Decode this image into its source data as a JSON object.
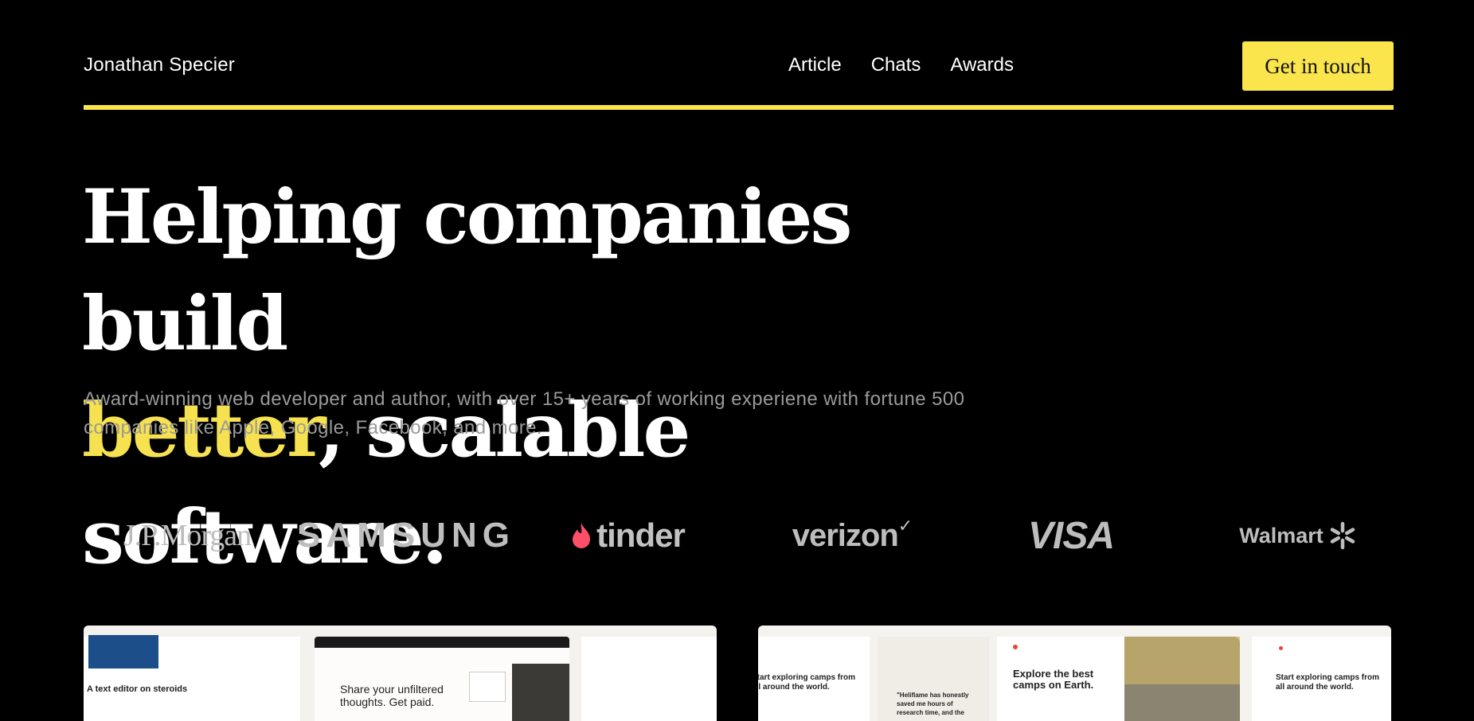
{
  "header": {
    "brand": "Jonathan Specier",
    "nav": [
      "Article",
      "Chats",
      "Awards"
    ],
    "cta_label": "Get in touch"
  },
  "hero": {
    "title_line1": "Helping companies build",
    "title_highlight": "better",
    "title_rest": ", scalable software.",
    "subtitle": "Award-winning web developer and author, with over 15+ years of working experiene with fortune 500 companies like Apple, Google, Facebook, and more."
  },
  "logos": {
    "jpmorgan": "J.P.Morgan",
    "samsung": "SAMSUNG",
    "tinder": "tinder",
    "verizon": "verizon",
    "visa": "VISA",
    "walmart": "Walmart"
  },
  "showcase": {
    "project1": {
      "headline": "Share your unfiltered thoughts. Get paid.",
      "side_left": "A text editor on steroids"
    },
    "project2": {
      "intro": "Start exploring camps from all around the world.",
      "quote": "\"Heliflame has honestly saved me hours of research time, and the",
      "headline": "Explore the best camps on Earth.",
      "intro_right": "Start exploring camps from all around the world."
    }
  },
  "colors": {
    "accent": "#fbe54d",
    "background": "#000000",
    "muted_text": "#9a9a9a",
    "logo_gray": "#bdbdbd"
  }
}
